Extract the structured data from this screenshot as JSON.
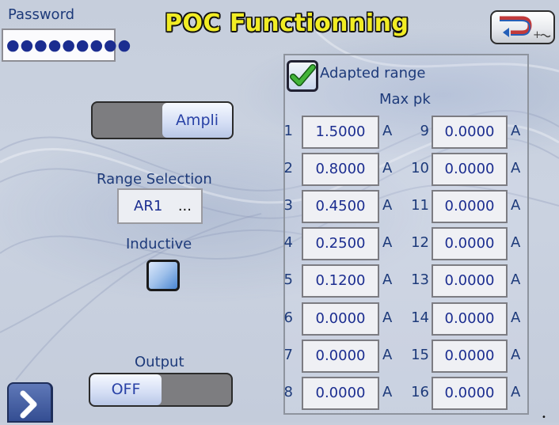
{
  "header": {
    "password_label": "Password",
    "password_value": "●●●●●●●●●",
    "title": "POC Functionning",
    "back_button_icon": "return-icon"
  },
  "left": {
    "mode_toggle_label": "Ampli",
    "range_selection_label": "Range Selection",
    "range_value": "AR1",
    "range_ellipsis": "...",
    "inductive_label": "Inductive",
    "inductive_checked": false,
    "output_label": "Output",
    "output_toggle_label": "OFF",
    "nav_icon": "chevron-right-icon"
  },
  "panel": {
    "adapted_range_label": "Adapted range",
    "adapted_range_checked": true,
    "max_pk_label": "Max pk",
    "unit": "A",
    "channels": [
      {
        "num": "1",
        "value": "1.5000"
      },
      {
        "num": "2",
        "value": "0.8000"
      },
      {
        "num": "3",
        "value": "0.4500"
      },
      {
        "num": "4",
        "value": "0.2500"
      },
      {
        "num": "5",
        "value": "0.1200"
      },
      {
        "num": "6",
        "value": "0.0000"
      },
      {
        "num": "7",
        "value": "0.0000"
      },
      {
        "num": "8",
        "value": "0.0000"
      },
      {
        "num": "9",
        "value": "0.0000"
      },
      {
        "num": "10",
        "value": "0.0000"
      },
      {
        "num": "11",
        "value": "0.0000"
      },
      {
        "num": "12",
        "value": "0.0000"
      },
      {
        "num": "13",
        "value": "0.0000"
      },
      {
        "num": "14",
        "value": "0.0000"
      },
      {
        "num": "15",
        "value": "0.0000"
      },
      {
        "num": "16",
        "value": "0.0000"
      }
    ]
  },
  "colors": {
    "title_yellow": "#f1ec24",
    "label_blue": "#1d3a7a",
    "value_blue": "#1b2d90",
    "check_green": "#3aa832"
  }
}
